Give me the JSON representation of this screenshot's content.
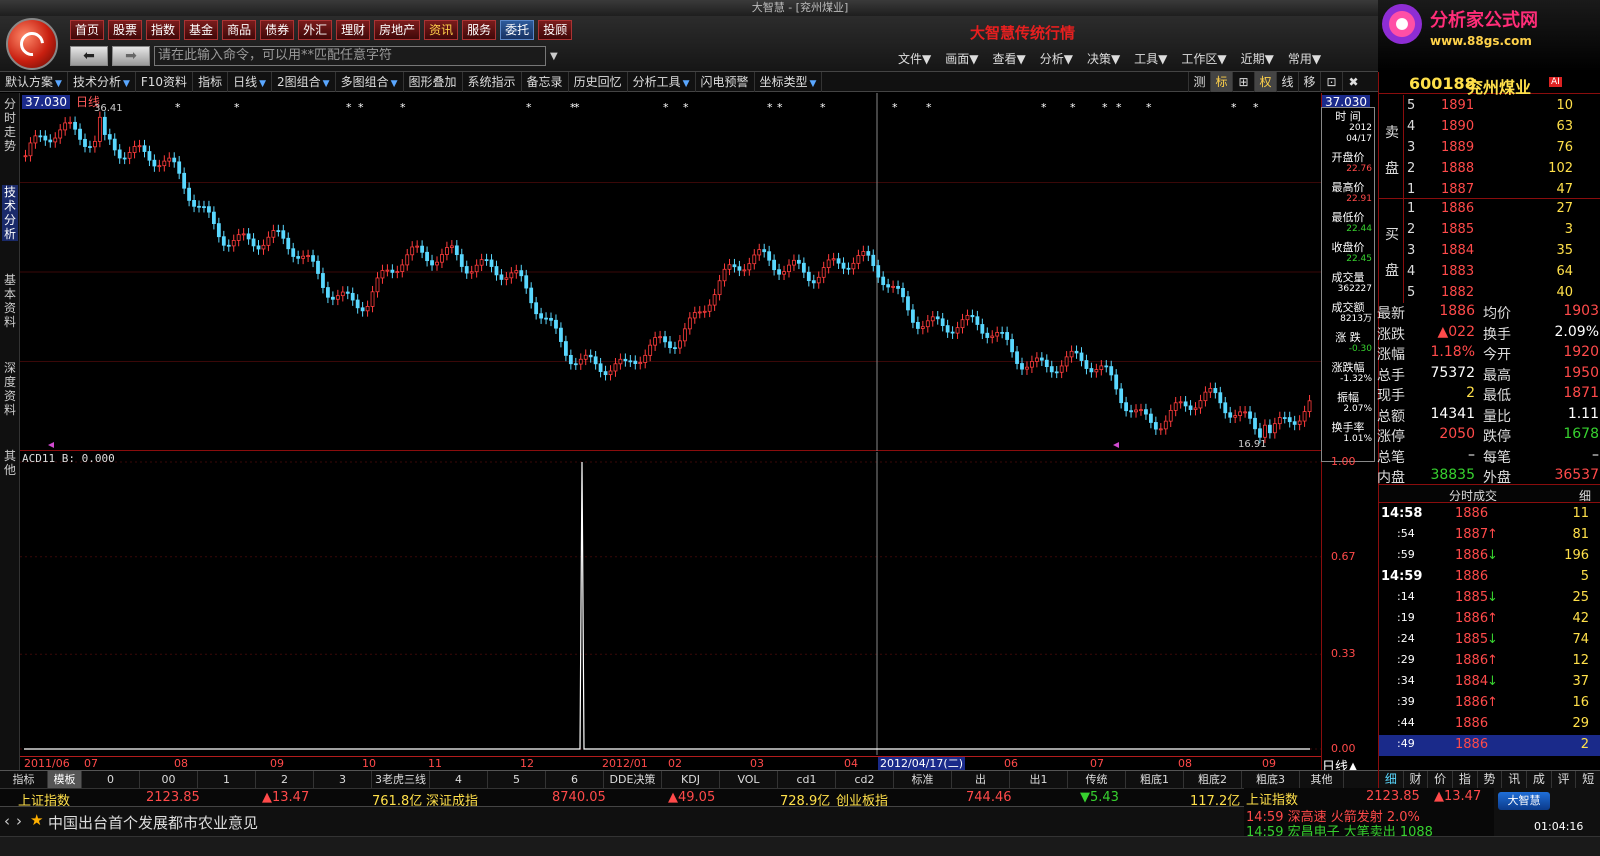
{
  "window": {
    "title": "大智慧 - [兖州煤业]"
  },
  "header": {
    "nav": [
      "首页",
      "股票",
      "指数",
      "基金",
      "商品",
      "债券",
      "外汇",
      "理财",
      "房地产",
      "资讯",
      "服务",
      "委托",
      "投顾"
    ],
    "cmd_placeholder": "请在此输入命令，可以用**匹配任意字符",
    "back_icon": "back-arrow-icon",
    "forward_icon": "forward-arrow-icon",
    "brand_text": "大智慧传统行情",
    "menus": [
      "文件▼",
      "画面▼",
      "查看▼",
      "分析▼",
      "决策▼",
      "工具▼",
      "工作区▼",
      "近期▼",
      "常用▼"
    ],
    "ad_title": "分析家公式网",
    "ad_url": "www.88gs.com"
  },
  "toolbar": {
    "items": [
      {
        "label": "默认方案",
        "drop": true
      },
      {
        "label": "技术分析",
        "drop": true
      },
      {
        "label": "F10资料",
        "drop": false
      },
      {
        "label": "指标",
        "drop": false
      },
      {
        "label": "日线",
        "drop": true
      },
      {
        "label": "2图组合",
        "drop": true
      },
      {
        "label": "多图组合",
        "drop": true
      },
      {
        "label": "图形叠加",
        "drop": false
      },
      {
        "label": "系统指示",
        "drop": false
      },
      {
        "label": "备忘录",
        "drop": false
      },
      {
        "label": "历史回忆",
        "drop": false
      },
      {
        "label": "分析工具",
        "drop": true
      },
      {
        "label": "闪电预警",
        "drop": false
      },
      {
        "label": "坐标类型",
        "drop": true
      }
    ],
    "right": [
      "测",
      "标",
      "⊞",
      "权",
      "线",
      "移",
      "⊡",
      "✖"
    ]
  },
  "left_tabs": [
    "分时走势",
    "技术分析",
    "基本资料",
    "深度资料",
    "其他"
  ],
  "chart": {
    "price_top_tag": "37.030",
    "period_label": "日线",
    "high_label": "36.41",
    "low_label": "16.91",
    "indicator_label": "ACD11  B: 0.000",
    "sub_axis": [
      "1.00",
      "0.67",
      "0.33",
      "0.00"
    ],
    "x_labels": [
      "2011/06",
      "07",
      "08",
      "09",
      "10",
      "11",
      "12",
      "2012/01",
      "02",
      "03",
      "04",
      "2012/04/17(二)",
      "06",
      "07",
      "08",
      "09"
    ],
    "period_tag": "日线▲",
    "info": [
      {
        "label": "时 间",
        "value": "2012"
      },
      {
        "label": "",
        "value": "04/17"
      },
      {
        "label": "开盘价",
        "value": "22.76"
      },
      {
        "label": "最高价",
        "value": "22.91"
      },
      {
        "label": "最低价",
        "value": "22.44"
      },
      {
        "label": "收盘价",
        "value": "22.45"
      },
      {
        "label": "成交量",
        "value": "362227"
      },
      {
        "label": "成交额",
        "value": "8213万"
      },
      {
        "label": "涨 跌",
        "value": "-0.30"
      },
      {
        "label": "涨跌幅",
        "value": "-1.32%"
      },
      {
        "label": "振幅",
        "value": "2.07%"
      },
      {
        "label": "换手率",
        "value": "1.01%"
      }
    ]
  },
  "chart_data": {
    "type": "candlestick",
    "x": [
      "2011/06",
      "07",
      "08",
      "09",
      "10",
      "11",
      "12",
      "2012/01",
      "02",
      "03",
      "04",
      "05",
      "06",
      "07",
      "08",
      "09"
    ],
    "close_approx": [
      33.5,
      35.2,
      30.5,
      27.5,
      25.0,
      28.5,
      24.0,
      19.8,
      25.5,
      27.5,
      26.0,
      22.6,
      21.5,
      18.5,
      18.0,
      17.8
    ],
    "high": 36.41,
    "low": 16.91,
    "indicator": {
      "name": "ACD11",
      "B": 0.0,
      "ylim": [
        0.0,
        1.0
      ],
      "spike_at": "2011/12 end",
      "spike_value": 1.0
    }
  },
  "bottom_tabs": [
    "指标",
    "模板",
    "0",
    "00",
    "1",
    "2",
    "3",
    "3老虎三线",
    "4",
    "5",
    "6",
    "DDE决策",
    "KDJ",
    "VOL",
    "cd1",
    "cd2",
    "标准",
    "出",
    "出1",
    "传统",
    "粗底1",
    "粗底2",
    "粗底3",
    "其他"
  ],
  "index_bar": [
    {
      "name": "上证指数",
      "value": "2123.85",
      "change": "▲13.47",
      "amount": "761.8亿"
    },
    {
      "name": "深证成指",
      "value": "8740.05",
      "change": "▲49.05",
      "amount": "728.9亿"
    },
    {
      "name": "创业板指",
      "value": "744.46",
      "change": "▼5.43",
      "amount": "117.2亿"
    }
  ],
  "news": "中国出台首个发展都市农业意见",
  "bottom_right": {
    "index_name": "上证指数",
    "index_value": "2123.85",
    "index_change": "▲13.47",
    "alert1": "14:59 深高速 火箭发射 2.0%",
    "alert2": "14:59 宏昌电子 大笔卖出 1088",
    "brand": "大智慧",
    "clock": "01:04:16"
  },
  "quote": {
    "code": "600188",
    "name": "兖州煤业",
    "ai_badge": "AI",
    "sell_label": "卖盘",
    "buy_label": "买盘",
    "asks": [
      {
        "lvl": "5",
        "price": "1891",
        "vol": "10"
      },
      {
        "lvl": "4",
        "price": "1890",
        "vol": "63"
      },
      {
        "lvl": "3",
        "price": "1889",
        "vol": "76"
      },
      {
        "lvl": "2",
        "price": "1888",
        "vol": "102"
      },
      {
        "lvl": "1",
        "price": "1887",
        "vol": "47"
      }
    ],
    "bids": [
      {
        "lvl": "1",
        "price": "1886",
        "vol": "27"
      },
      {
        "lvl": "2",
        "price": "1885",
        "vol": "3"
      },
      {
        "lvl": "3",
        "price": "1884",
        "vol": "35"
      },
      {
        "lvl": "4",
        "price": "1883",
        "vol": "64"
      },
      {
        "lvl": "5",
        "price": "1882",
        "vol": "40"
      }
    ],
    "stats": [
      {
        "l1": "最新",
        "v1": "1886",
        "c1": "red",
        "l2": "均价",
        "v2": "1903",
        "c2": "red"
      },
      {
        "l1": "涨跌",
        "v1": "▲022",
        "c1": "red",
        "l2": "换手",
        "v2": "2.09%",
        "c2": "wht"
      },
      {
        "l1": "涨幅",
        "v1": "1.18%",
        "c1": "red",
        "l2": "今开",
        "v2": "1920",
        "c2": "red"
      },
      {
        "l1": "总手",
        "v1": "75372",
        "c1": "wht",
        "l2": "最高",
        "v2": "1950",
        "c2": "red"
      },
      {
        "l1": "现手",
        "v1": "2",
        "c1": "yel",
        "l2": "最低",
        "v2": "1871",
        "c2": "red"
      },
      {
        "l1": "总额",
        "v1": "14341",
        "c1": "wht",
        "l2": "量比",
        "v2": "1.11",
        "c2": "wht"
      },
      {
        "l1": "涨停",
        "v1": "2050",
        "c1": "red",
        "l2": "跌停",
        "v2": "1678",
        "c2": "grn"
      },
      {
        "l1": "总笔",
        "v1": "–",
        "c1": "wht",
        "l2": "每笔",
        "v2": "–",
        "c2": "wht"
      },
      {
        "l1": "内盘",
        "v1": "38835",
        "c1": "grn",
        "l2": "外盘",
        "v2": "36537",
        "c2": "red"
      }
    ],
    "ticks_header": "分时成交",
    "ticks_header_right": "细",
    "ticks": [
      {
        "t": "14:58",
        "p": "1886",
        "arrow": "",
        "v": "11",
        "tcls": "wht"
      },
      {
        "t": ":54",
        "p": "1887",
        "arrow": "↑",
        "v": "81",
        "tcls": "wht"
      },
      {
        "t": ":59",
        "p": "1886",
        "arrow": "↓",
        "v": "196",
        "tcls": "wht"
      },
      {
        "t": "14:59",
        "p": "1886",
        "arrow": "",
        "v": "5",
        "tcls": "wht"
      },
      {
        "t": ":14",
        "p": "1885",
        "arrow": "↓",
        "v": "25",
        "tcls": "wht"
      },
      {
        "t": ":19",
        "p": "1886",
        "arrow": "↑",
        "v": "42",
        "tcls": "wht"
      },
      {
        "t": ":24",
        "p": "1885",
        "arrow": "↓",
        "v": "74",
        "tcls": "wht"
      },
      {
        "t": ":29",
        "p": "1886",
        "arrow": "↑",
        "v": "12",
        "tcls": "wht"
      },
      {
        "t": ":34",
        "p": "1884",
        "arrow": "↓",
        "v": "37",
        "tcls": "wht"
      },
      {
        "t": ":39",
        "p": "1886",
        "arrow": "↑",
        "v": "16",
        "tcls": "wht"
      },
      {
        "t": ":44",
        "p": "1886",
        "arrow": "",
        "v": "29",
        "tcls": "wht"
      },
      {
        "t": ":49",
        "p": "1886",
        "arrow": "",
        "v": "2",
        "tcls": "wht"
      }
    ],
    "right_tabs": [
      "细",
      "财",
      "价",
      "指",
      "势",
      "讯",
      "成",
      "评",
      "短"
    ]
  }
}
